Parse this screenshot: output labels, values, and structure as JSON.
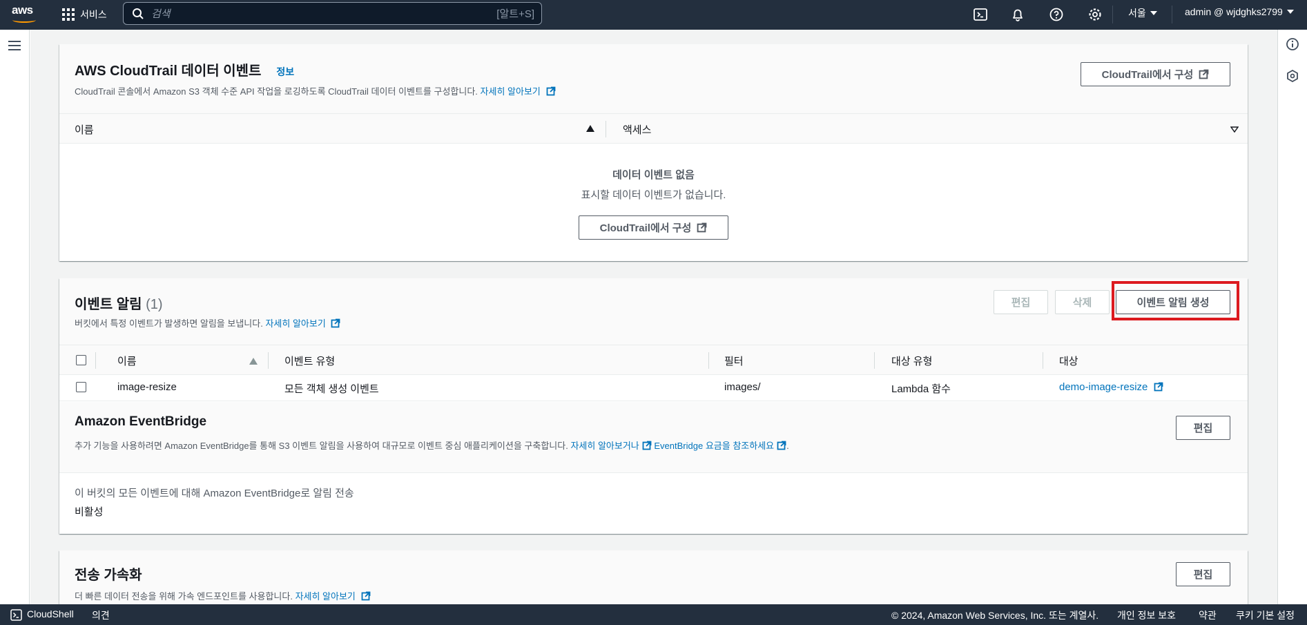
{
  "topnav": {
    "logo_text": "aws",
    "services_label": "서비스",
    "search_placeholder": "검색",
    "search_shortcut": "[알트+S]",
    "icons": [
      "cloudshell-icon",
      "bell-icon",
      "help-icon",
      "settings-icon"
    ],
    "region": "서울",
    "account": "admin @ wjdghks2799"
  },
  "cloudtrail": {
    "title": "AWS CloudTrail 데이터 이벤트",
    "info": "정보",
    "desc": "CloudTrail 콘솔에서 Amazon S3 객체 수준 API 작업을 로깅하도록 CloudTrail 데이터 이벤트를 구성합니다.",
    "learn_more": "자세히 알아보기",
    "config_button": "CloudTrail에서 구성",
    "columns": [
      "이름",
      "액세스"
    ],
    "empty_title": "데이터 이벤트 없음",
    "empty_desc": "표시할 데이터 이벤트가 없습니다.",
    "empty_button": "CloudTrail에서 구성"
  },
  "event_notifications": {
    "title": "이벤트 알림",
    "count": "(1)",
    "desc": "버킷에서 특정 이벤트가 발생하면 알림을 보냅니다.",
    "learn_more": "자세히 알아보기",
    "edit_button": "편집",
    "delete_button": "삭제",
    "create_button": "이벤트 알림 생성",
    "columns": [
      "이름",
      "이벤트 유형",
      "필터",
      "대상 유형",
      "대상"
    ],
    "rows": [
      {
        "name": "image-resize",
        "event_type": "모든 객체 생성 이벤트",
        "filter": "images/",
        "dest_type": "Lambda 함수",
        "dest": "demo-image-resize"
      }
    ]
  },
  "eventbridge": {
    "title": "Amazon EventBridge",
    "desc": "추가 기능을 사용하려면 Amazon EventBridge를 통해 S3 이벤트 알림을 사용하여 대규모로 이벤트 중심 애플리케이션을 구축합니다.",
    "learn_more": "자세히 알아보거나",
    "pricing_link": "EventBridge 요금을 참조하세요",
    "period": ".",
    "edit_button": "편집",
    "field_label": "이 버킷의 모든 이벤트에 대해 Amazon EventBridge로 알림 전송",
    "field_value": "비활성"
  },
  "transfer_accel": {
    "title": "전송 가속화",
    "desc": "더 빠른 데이터 전송을 위해 가속 엔드포인트를 사용합니다.",
    "learn_more": "자세히 알아보기",
    "edit_button": "편집"
  },
  "footer": {
    "cloudshell": "CloudShell",
    "feedback": "의견",
    "copyright": "© 2024, Amazon Web Services, Inc. 또는 계열사.",
    "privacy": "개인 정보 보호",
    "terms": "약관",
    "cookies": "쿠키 기본 설정"
  },
  "colors": {
    "nav_bg": "#232f3e",
    "link": "#0073bb",
    "highlight": "#dc1a1f",
    "accent": "#ff9900"
  }
}
